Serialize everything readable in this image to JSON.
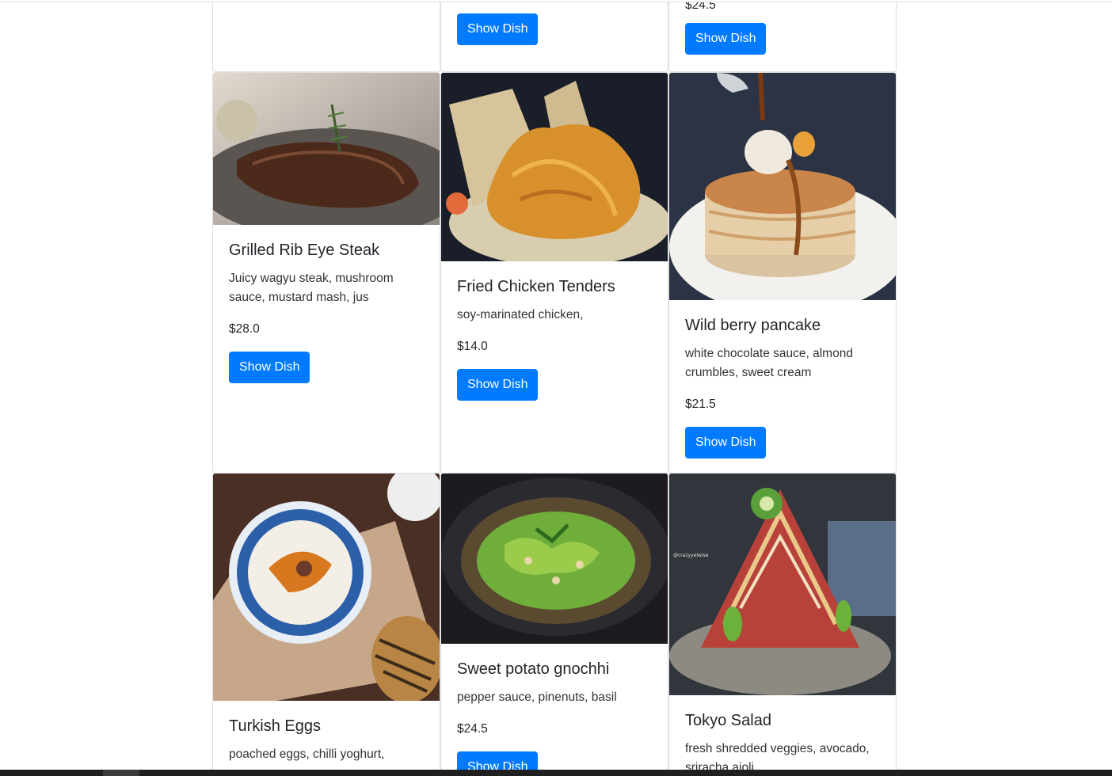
{
  "top_row": [
    {
      "title": "",
      "description": "",
      "price": "",
      "button": ""
    },
    {
      "title": "",
      "description": "",
      "price": "",
      "button": "Show Dish"
    },
    {
      "title": "",
      "description": "",
      "price": "$24.5",
      "button": "Show Dish"
    }
  ],
  "dishes": [
    {
      "title": "Grilled Rib Eye Steak",
      "description": "Juicy wagyu steak, mushroom sauce, mustard mash, jus",
      "price": "$28.0",
      "button": "Show Dish",
      "image": "steak-photo"
    },
    {
      "title": "Fried Chicken Tenders",
      "description": "soy-marinated chicken,",
      "price": "$14.0",
      "button": "Show Dish",
      "image": "fried-chicken-photo"
    },
    {
      "title": "Wild berry pancake",
      "description": "white chocolate sauce, almond crumbles, sweet cream",
      "price": "$21.5",
      "button": "Show Dish",
      "image": "pancake-photo"
    },
    {
      "title": "Turkish Eggs",
      "description": "poached eggs, chilli yoghurt,",
      "price": "",
      "button": "",
      "image": "turkish-eggs-photo"
    },
    {
      "title": "Sweet potato gnochhi",
      "description": "pepper sauce, pinenuts, basil",
      "price": "$24.5",
      "button": "Show Dish",
      "image": "gnocchi-photo"
    },
    {
      "title": "Tokyo Salad",
      "description": "fresh shredded veggies, avocado, sriracha aioli",
      "price": "",
      "button": "",
      "image": "salad-photo",
      "watermark": "@crazyyelwise"
    }
  ],
  "colors": {
    "button": "#007bff",
    "border": "#dfdfdf",
    "text": "#212529"
  }
}
